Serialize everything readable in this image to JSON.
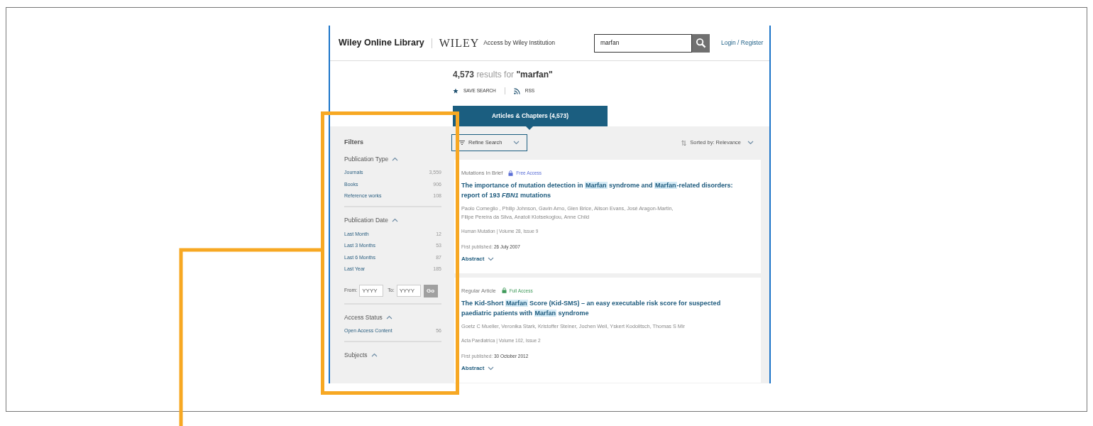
{
  "header": {
    "site_name": "Wiley Online Library",
    "brand": "WILEY",
    "access_note": "Access by Wiley Institution",
    "search": {
      "value": "marfan"
    },
    "login": "Login / Register"
  },
  "results": {
    "count": "4,573",
    "label": "results for",
    "query": "\"marfan\""
  },
  "actions": [
    {
      "kind": "star",
      "label": "SAVE SEARCH"
    },
    {
      "kind": "rss",
      "label": "RSS"
    }
  ],
  "tabs": [
    {
      "label": "Articles & Chapters (4,573)",
      "selected": true
    }
  ],
  "filters": {
    "title": "Filters",
    "groups": [
      {
        "title": "Publication Type",
        "expanded": true,
        "items": [
          {
            "label": "Journals",
            "count": "3,559"
          },
          {
            "label": "Books",
            "count": "906"
          },
          {
            "label": "Reference works",
            "count": "108"
          }
        ]
      },
      {
        "title": "Publication Date",
        "expanded": true,
        "items": [
          {
            "label": "Last Month",
            "count": "12"
          },
          {
            "label": "Last 3 Months",
            "count": "53"
          },
          {
            "label": "Last 6 Months",
            "count": "87"
          },
          {
            "label": "Last Year",
            "count": "185"
          }
        ],
        "range": {
          "from_label": "From:",
          "from_placeholder": "YYYY",
          "to_label": "To:",
          "to_placeholder": "YYYY",
          "button": "Go"
        }
      },
      {
        "title": "Access Status",
        "expanded": true,
        "items": [
          {
            "label": "Open Access Content",
            "count": "56"
          }
        ]
      },
      {
        "title": "Subjects",
        "expanded": true
      }
    ]
  },
  "toolbar": {
    "refine": "Refine Search",
    "sort": "Sorted by: Relevance"
  },
  "articles": [
    {
      "type": "Mutations In Brief",
      "color": "#5b6fd6",
      "access": "Free Access",
      "title": [
        {
          "text": "The importance of mutation detection in ",
          "highlight": false
        },
        {
          "text": "Marfan",
          "highlight": true
        },
        {
          "text": " syndrome and ",
          "highlight": false
        },
        {
          "text": "Marfan",
          "highlight": true
        },
        {
          "text": "-related disorders: report of 193 *FBN1* mutations",
          "highlight": false
        }
      ],
      "authors": [
        "Paolo Comeglio , Philip Johnson, Gavin Arno, Glen Brice, Alison Evans, José Aragon-Martin,",
        "Filipe Pereira da Silva, Anatoli Klotsekoglou, Anne Child"
      ],
      "journal": "Human Mutation | Volume 28, Issue 9",
      "published_label": "First published:",
      "published_date": "26 July 2007",
      "abstract": "Abstract"
    },
    {
      "type": "Regular Article",
      "color": "#3f9a5a",
      "access": "Full Access",
      "title": [
        {
          "text": "The Kid-Short ",
          "highlight": false
        },
        {
          "text": "Marfan",
          "highlight": true
        },
        {
          "text": " Score (Kid-SMS) – an easy executable risk score for suspected paediatric patients with ",
          "highlight": false
        },
        {
          "text": "Marfan",
          "highlight": true
        },
        {
          "text": " syndrome",
          "highlight": false
        }
      ],
      "authors": [
        "Goetz C Mueller, Veronika Stark, Kristoffer Steiner, Jochen Weil, Yskert Kodolitsch, Thomas S Mir"
      ],
      "journal": "Acta Paediatrica | Volume 102, Issue 2",
      "published_label": "First published:",
      "published_date": "30 October 2012",
      "abstract": "Abstract"
    }
  ]
}
